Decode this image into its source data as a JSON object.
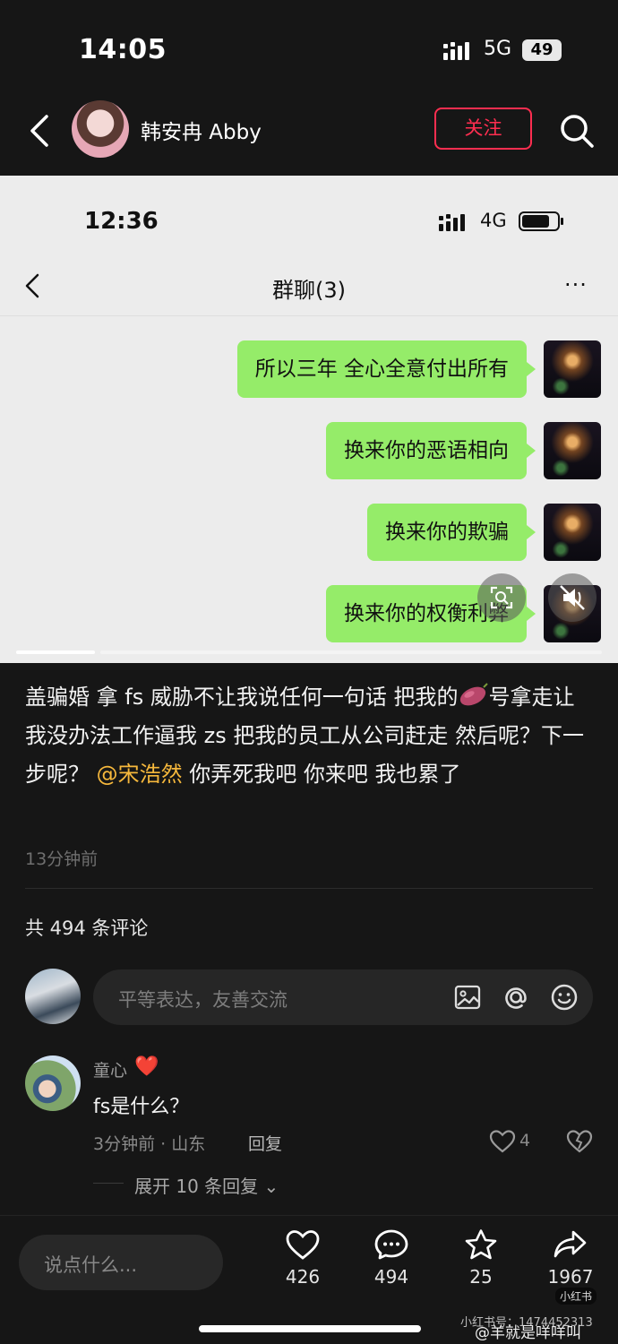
{
  "status_bar": {
    "time": "14:05",
    "network": "5G",
    "battery": "49"
  },
  "header": {
    "author_name": "韩安冉 Abby",
    "follow_label": "关注"
  },
  "embedded_screenshot": {
    "time": "12:36",
    "network": "4G",
    "title": "群聊(3)",
    "more": "···",
    "messages": [
      "所以三年 全心全意付出所有",
      "换来你的恶语相向",
      "换来你的欺骗",
      "换来你的权衡利弊"
    ]
  },
  "post": {
    "text_before_emoji": "盖骗婚 拿 fs 威胁不让我说任何一句话 把我的",
    "emoji_name": "sweet-potato-emoji",
    "text_after_emoji": "号拿走让我没办法工作逼我 zs 把我的员工从公司赶走 然后呢？下一步呢？",
    "mention": "@宋浩然",
    "text_end": " 你弄死我吧 你来吧 我也累了",
    "time": "13分钟前"
  },
  "comments": {
    "count_label": "共 494 条评论",
    "input_placeholder": "平等表达，友善交流",
    "items": [
      {
        "user": "童心",
        "badge": "❤️",
        "text": "fs是什么？",
        "meta": "3分钟前 · 山东",
        "reply_label": "回复",
        "likes": "4",
        "expand_label": "展开 10 条回复"
      }
    ]
  },
  "bottom_bar": {
    "say_placeholder": "说点什么...",
    "likes": "426",
    "comments": "494",
    "favorites": "25",
    "shares": "1967"
  },
  "watermark": {
    "app": "小红书",
    "id_text": "小红书号：1474452313",
    "weibo": "@羊就是咩咩叫"
  },
  "colors": {
    "accent": "#ff2e50",
    "mention": "#f6b83c",
    "chat_bubble": "#95ec69"
  }
}
